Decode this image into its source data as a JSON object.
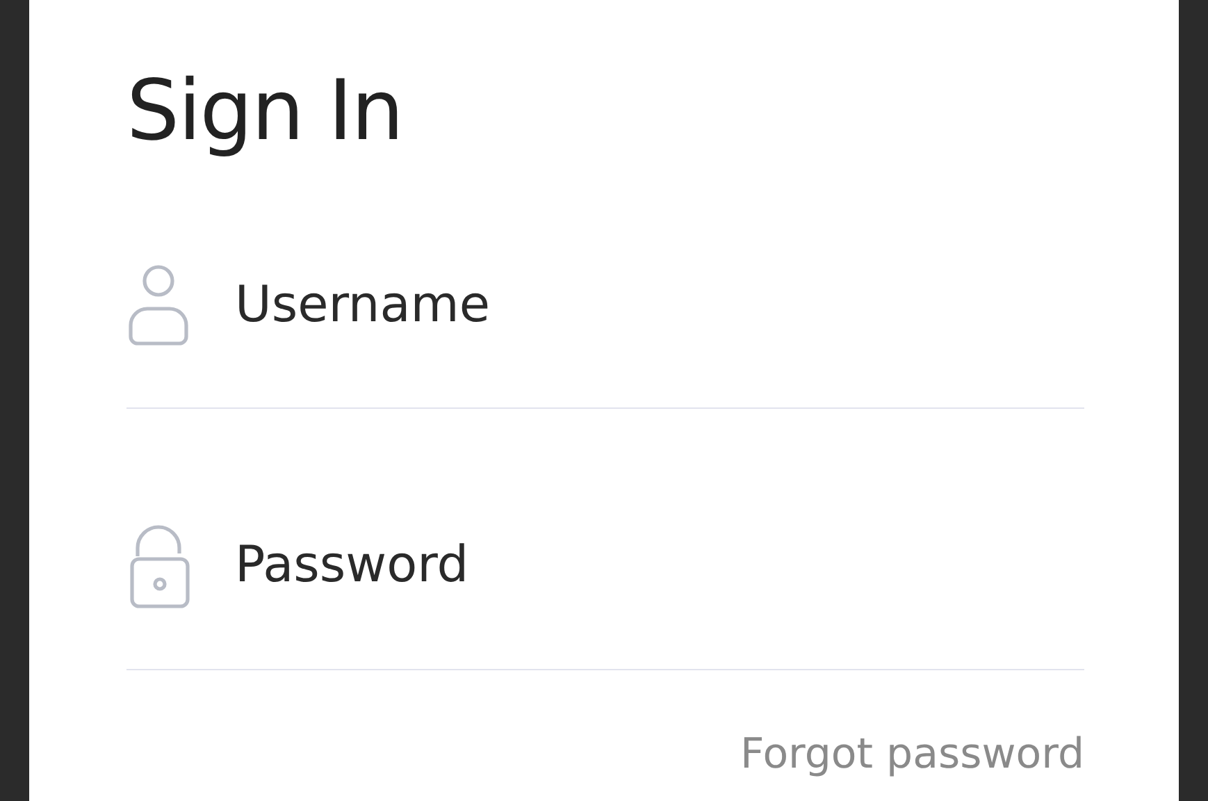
{
  "title": "Sign In",
  "fields": [
    {
      "kind": "user",
      "placeholder": "Username"
    },
    {
      "kind": "lock",
      "placeholder": "Password"
    }
  ],
  "forgot_link": "Forgot password"
}
